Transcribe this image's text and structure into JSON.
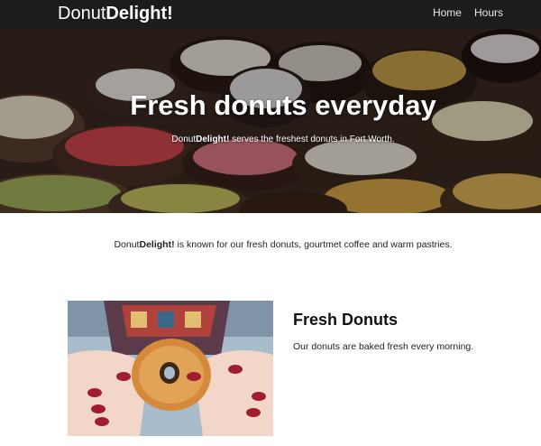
{
  "nav": {
    "brand_prefix": "Donut",
    "brand_bold": "Delight!",
    "links": [
      {
        "label": "Home"
      },
      {
        "label": "Hours"
      }
    ]
  },
  "hero": {
    "title": "Fresh donuts everyday",
    "subtitle_brand_prefix": "Donut",
    "subtitle_brand_bold": "Delight!",
    "subtitle_rest": "serves the freshest donuts in Fort Worth."
  },
  "intro": {
    "brand_prefix": "Donut",
    "brand_bold": "Delight!",
    "text": "is known for our fresh donuts, gourtmet coffee and warm pastries."
  },
  "feature": {
    "title": "Fresh Donuts",
    "text": "Our donuts are baked fresh every morning."
  },
  "colors": {
    "nav_bg": "#1c1c1c",
    "hero_bg": "#3a2b25",
    "text": "#222222"
  }
}
